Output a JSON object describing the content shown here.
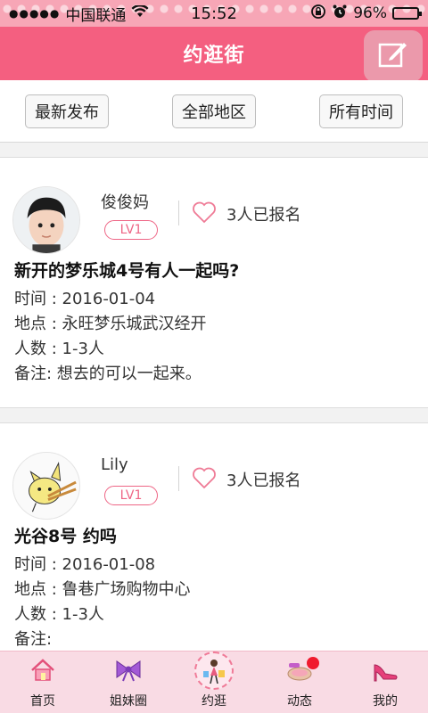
{
  "status_bar": {
    "carrier": "中国联通",
    "time": "15:52",
    "battery": "96%"
  },
  "header": {
    "title": "约逛街",
    "compose_icon": "compose-icon"
  },
  "filters": [
    {
      "label": "最新发布"
    },
    {
      "label": "全部地区"
    },
    {
      "label": "所有时间"
    }
  ],
  "posts": [
    {
      "username": "俊俊妈",
      "level": "LV1",
      "signup": "3人已报名",
      "title": "新开的梦乐城4号有人一起吗?",
      "time": "时间 : 2016-01-04",
      "place": "地点 : 永旺梦乐城武汉经开",
      "people": "人数 : 1-3人",
      "note": "备注: 想去的可以一起来。"
    },
    {
      "username": "Lily",
      "level": "LV1",
      "signup": "3人已报名",
      "title": "光谷8号 约吗",
      "time": "时间 : 2016-01-08",
      "place": "地点 : 鲁巷广场购物中心",
      "people": "人数 : 1-3人",
      "note": "备注:"
    }
  ],
  "tabs": [
    {
      "label": "首页",
      "icon": "home-icon"
    },
    {
      "label": "姐妹圈",
      "icon": "bow-icon"
    },
    {
      "label": "约逛",
      "icon": "shopping-girl-icon",
      "active": true
    },
    {
      "label": "动态",
      "icon": "makeup-icon",
      "badge": true
    },
    {
      "label": "我的",
      "icon": "high-heel-icon"
    }
  ],
  "colors": {
    "brand": "#f45f80",
    "level_border": "#ee6585",
    "tabbar_bg": "#f9dbe4"
  }
}
